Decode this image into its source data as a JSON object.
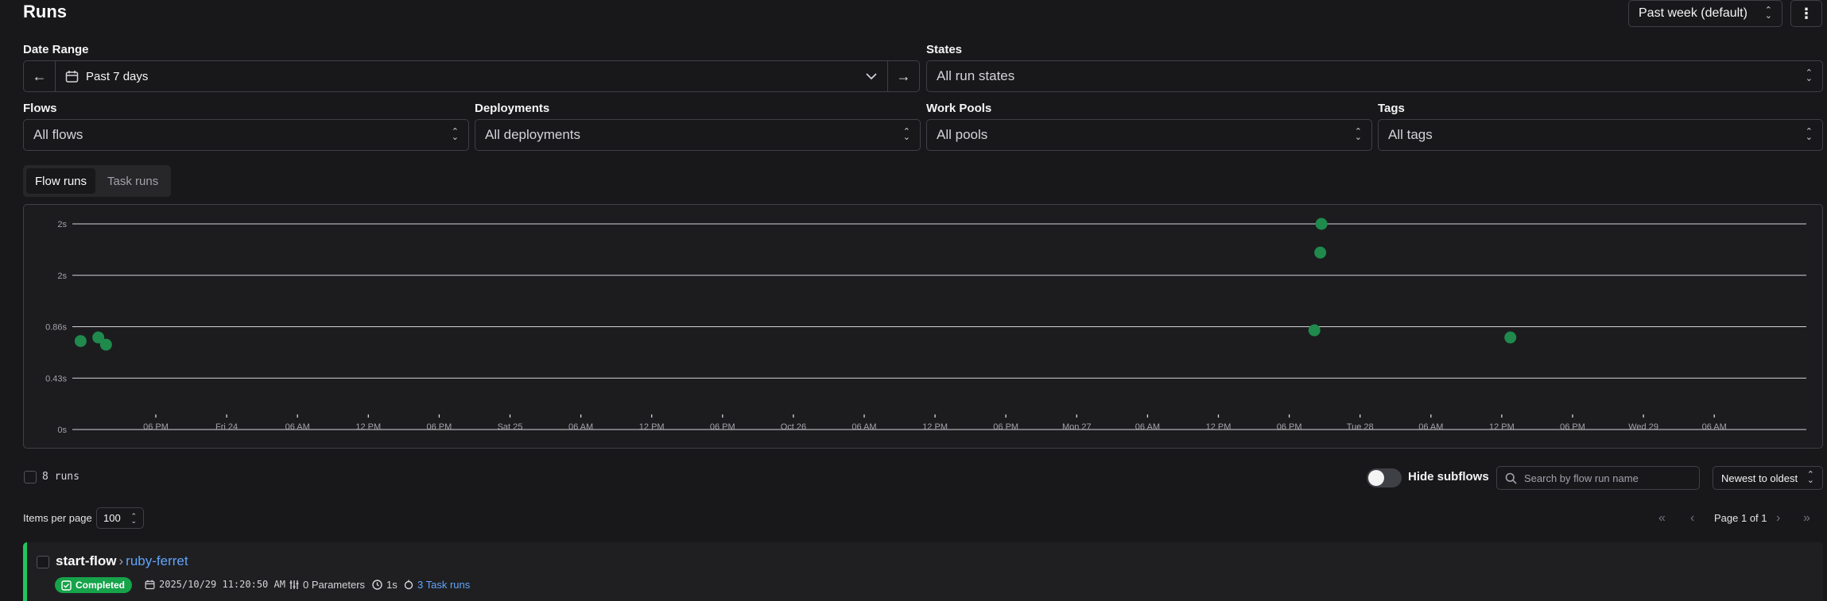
{
  "page": {
    "title": "Runs",
    "range_select": "Past week (default)",
    "more_glyph": "⋮"
  },
  "filters": {
    "date_range_label": "Date Range",
    "date_range_value": "Past 7 days",
    "states_label": "States",
    "states_value": "All run states",
    "flows_label": "Flows",
    "flows_value": "All flows",
    "deployments_label": "Deployments",
    "deployments_value": "All deployments",
    "work_pools_label": "Work Pools",
    "work_pools_value": "All pools",
    "tags_label": "Tags",
    "tags_value": "All tags"
  },
  "tabs": [
    {
      "label": "Flow runs",
      "active": true
    },
    {
      "label": "Task runs",
      "active": false
    }
  ],
  "chart_data": {
    "type": "scatter",
    "y_ticks": [
      "0s",
      "0.43s",
      "0.86s",
      "2s",
      "2s"
    ],
    "ylim": [
      0,
      1.72
    ],
    "x_ticks": [
      "06 PM",
      "Fri 24",
      "06 AM",
      "12 PM",
      "06 PM",
      "Sat 25",
      "06 AM",
      "12 PM",
      "06 PM",
      "Oct 26",
      "06 AM",
      "12 PM",
      "06 PM",
      "Mon 27",
      "06 AM",
      "12 PM",
      "06 PM",
      "Tue 28",
      "06 AM",
      "12 PM",
      "06 PM",
      "Wed 29",
      "06 AM"
    ],
    "series": [
      {
        "color": "#1f8a4c",
        "points": [
          {
            "x": 0.7,
            "y": 0.74
          },
          {
            "x": 2.2,
            "y": 0.77
          },
          {
            "x": 2.85,
            "y": 0.71
          },
          {
            "x": 105.2,
            "y": 0.83
          },
          {
            "x": 105.7,
            "y": 1.48
          },
          {
            "x": 105.8,
            "y": 1.72
          },
          {
            "x": 121.8,
            "y": 0.77
          }
        ]
      }
    ]
  },
  "list": {
    "count_label": "8 runs",
    "hide_subflows_label": "Hide subflows",
    "search_placeholder": "Search by flow run name",
    "sort_value": "Newest to oldest",
    "items_per_page_label": "Items per page",
    "items_per_page_value": "100",
    "page_label": "Page 1 of 1",
    "first_glyph": "«",
    "prev_glyph": "‹",
    "next_glyph": "›",
    "last_glyph": "»"
  },
  "runs": [
    {
      "flow_name": "start-flow",
      "separator": "›",
      "run_name": "ruby-ferret",
      "state": "Completed",
      "state_color": "#16a34a",
      "timestamp": "2025/10/29 11:20:50 AM",
      "parameters": "0 Parameters",
      "duration": "1s",
      "task_runs": "3 Task runs"
    }
  ]
}
